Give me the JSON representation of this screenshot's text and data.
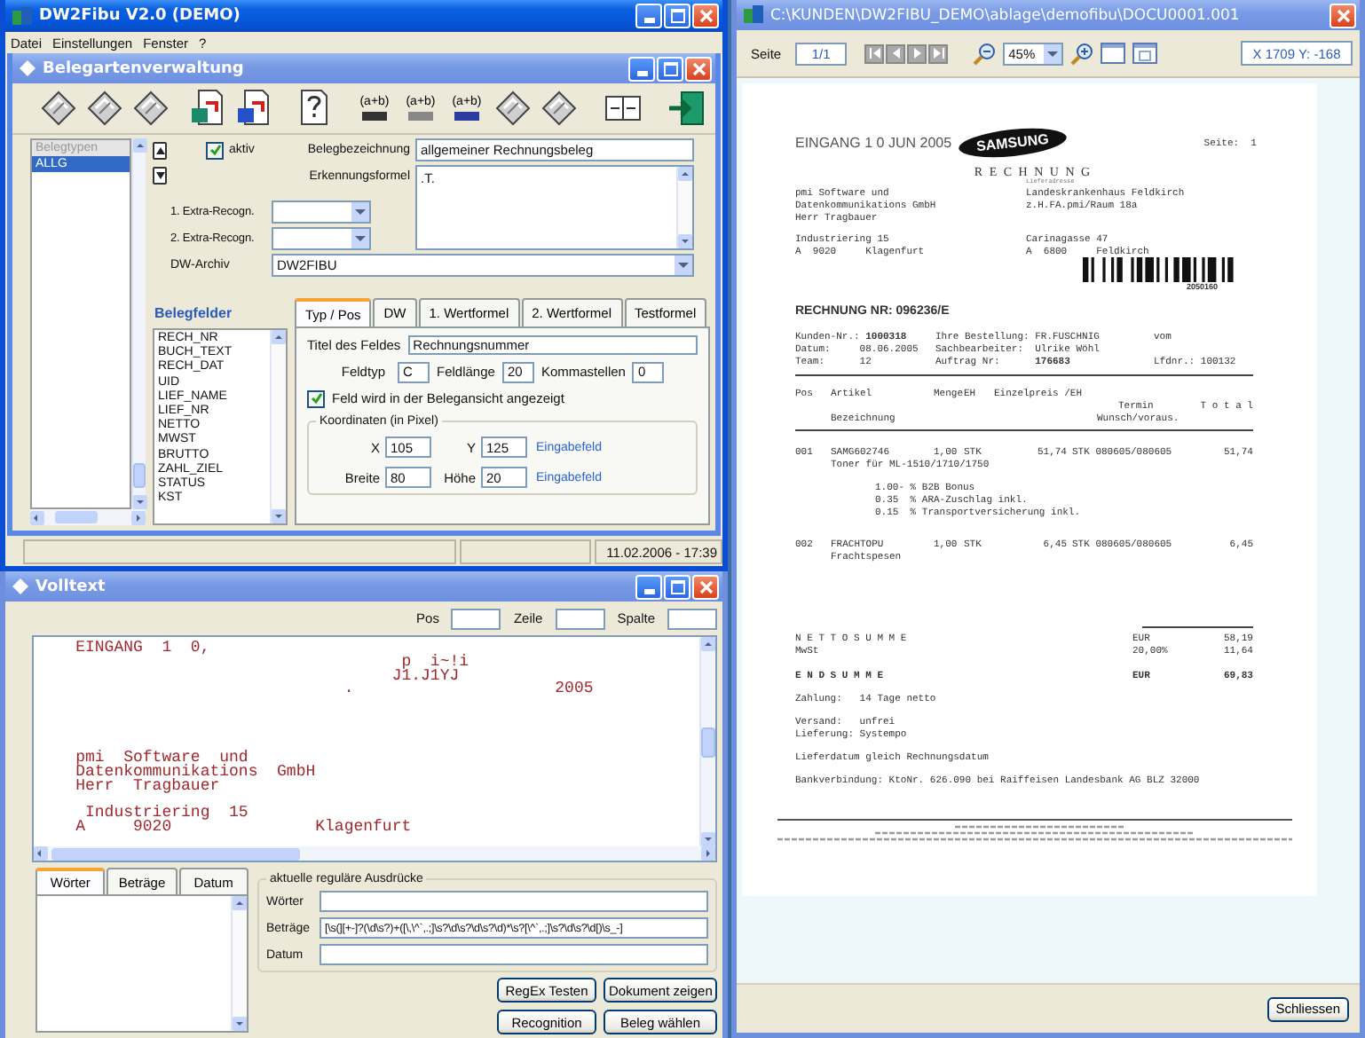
{
  "main_window": {
    "title": "DW2Fibu V2.0 (DEMO)",
    "menu": [
      "Datei",
      "Einstellungen",
      "Fenster",
      "?"
    ]
  },
  "belegarten": {
    "title": "Belegartenverwaltung",
    "toolbar": [
      {
        "kind": "tool"
      },
      {
        "kind": "tool"
      },
      {
        "kind": "tool"
      },
      {
        "kind": "page"
      },
      {
        "kind": "page"
      },
      {
        "kind": "help"
      },
      {
        "kind": "formula",
        "label": "(a+b)"
      },
      {
        "kind": "formula",
        "label": "(a+b)"
      },
      {
        "kind": "formula",
        "label": "(a+b)"
      },
      {
        "kind": "tool"
      },
      {
        "kind": "tool"
      },
      {
        "kind": "split"
      },
      {
        "kind": "exit"
      }
    ],
    "belegtypen": {
      "header": "Belegtypen",
      "items": [
        {
          "label": "ALLG",
          "selected": true
        }
      ]
    },
    "aktiv": {
      "label": "aktiv",
      "checked": true
    },
    "bezeichnung": {
      "label": "Belegbezeichnung",
      "value": "allgemeiner Rechnungsbeleg"
    },
    "formel": {
      "label": "Erkennungsformel",
      "value": ".T."
    },
    "extra_recogn": [
      {
        "label": "1. Extra-Recogn."
      },
      {
        "label": "2. Extra-Recogn."
      }
    ],
    "archiv": {
      "label": "DW-Archiv",
      "value": "DW2FIBU"
    },
    "belegfelder": {
      "title": "Belegfelder",
      "items": [
        {
          "label": "RECH_NR",
          "selected": false
        },
        {
          "label": "BUCH_TEXT",
          "selected": false
        },
        {
          "label": "RECH_DAT",
          "selected": false
        },
        {
          "label": "UID",
          "selected": false
        },
        {
          "label": "LIEF_NAME",
          "selected": false
        },
        {
          "label": "LIEF_NR",
          "selected": false
        },
        {
          "label": "NETTO",
          "selected": false
        },
        {
          "label": "MWST",
          "selected": false
        },
        {
          "label": "BRUTTO",
          "selected": false
        },
        {
          "label": "ZAHL_ZIEL",
          "selected": false
        },
        {
          "label": "STATUS",
          "selected": false
        },
        {
          "label": "KST",
          "selected": false
        }
      ]
    },
    "tabs": [
      {
        "label": "Typ / Pos",
        "selected": true
      },
      {
        "label": "DW",
        "selected": false
      },
      {
        "label": "1. Wertformel",
        "selected": false
      },
      {
        "label": "2. Wertformel",
        "selected": false
      },
      {
        "label": "Testformel",
        "selected": false
      }
    ],
    "panel": {
      "titel": {
        "label": "Titel des Feldes",
        "value": "Rechnungsnummer"
      },
      "feldtyp": {
        "label": "Feldtyp",
        "value": "C"
      },
      "feldlaenge": {
        "label": "Feldlänge",
        "value": "20"
      },
      "komma": {
        "label": "Kommastellen",
        "value": "0"
      },
      "anzeigen": {
        "label": "Feld wird in der Belegansicht angezeigt",
        "checked": true
      },
      "koordinaten": {
        "title": "Koordinaten (in Pixel)",
        "rows": [
          {
            "label_a": "X",
            "value_a": "105",
            "label_b": "Y",
            "value_b": "125",
            "link": "Eingabefeld"
          },
          {
            "label_a": "Breite",
            "value_a": "80",
            "label_b": "Höhe",
            "value_b": "20",
            "link": "Eingabefeld"
          }
        ]
      }
    }
  },
  "status_bar": {
    "datetime": "11.02.2006 - 17:39"
  },
  "volltext": {
    "title": "Volltext",
    "pos_label": "Pos",
    "zeile_label": "Zeile",
    "spalte_label": "Spalte",
    "ocr_text": "    EINGANG  1  0,\n                                      p  i~!i\n                                     J1.J1YJ\n                                .                     2005\n\n\n\n\n    pmi  Software  und\n    Datenkommunikations  GmbH\n    Herr  Tragbauer\n\n     Industriering  15\n    A     9020               Klagenfurt",
    "tabs": [
      {
        "label": "Wörter",
        "selected": true
      },
      {
        "label": "Beträge",
        "selected": false
      },
      {
        "label": "Datum",
        "selected": false
      }
    ],
    "regex_title": "aktuelle reguläre Ausdrücke",
    "regex_rows": [
      {
        "label": "Wörter"
      },
      {
        "label": "Beträge",
        "value": "[\\s(][+-]?(\\d\\s?)+([\\,\\^`,.;]\\s?\\d\\s?\\d\\s?\\d)*\\s?[\\^`,.;]\\s?\\d\\s?\\d[)\\s_-]"
      },
      {
        "label": "Datum"
      }
    ],
    "buttons": [
      "RegEx Testen",
      "Dokument zeigen",
      "Recognition",
      "Beleg wählen"
    ]
  },
  "viewer": {
    "title": "C:\\KUNDEN\\DW2FIBU_DEMO\\ablage\\demofibu\\DOCU0001.001",
    "page_label": "Seite",
    "page": "1/1",
    "zoom": "45%",
    "coords": "X 1709 Y: -168",
    "close_button": "Schliessen",
    "document": {
      "stamp": "EINGANG 1 0 JUN 2005",
      "logo": "SAMSUNG",
      "page_no": "Seite:  1",
      "heading": "R E C H N U N G",
      "delivery_label": "Lieferadresse",
      "address": [
        [
          "pmi Software und",
          "Landeskrankenhaus Feldkirch"
        ],
        [
          "Datenkommunikations GmbH",
          "z.H.FA.pmi/Raum 18a"
        ],
        [
          "Herr Tragbauer"
        ]
      ],
      "address2": [
        [
          "Industriering 15",
          "Carinagasse 47"
        ],
        [
          "A  9020     Klagenfurt",
          "A  6800     Feldkirch"
        ]
      ],
      "barcode_number": "2050160",
      "invoice_no": "RECHNUNG NR: 096236/E",
      "info": [
        [
          "Kunden-Nr.: **1000318**",
          "Ihre Bestellung: FR.FUSCHNIG",
          "vom"
        ],
        [
          "Datum:     08.06.2005",
          "Sachbearbeiter:  Ulrike Wöhl"
        ],
        [
          "Team:      12",
          "Auftrag Nr:      **176683**",
          "Lfdnr.: 100132"
        ]
      ],
      "table_head": [
        "Pos",
        "Artikel",
        "Menge",
        "EH",
        "Einzelpreis /EH",
        "Termin",
        "T o t a l"
      ],
      "table_head2": [
        "Bezeichnung",
        "Wunsch/voraus."
      ],
      "items": [
        {
          "kind": "line",
          "cells": [
            "001",
            "SAMG602746",
            "1,00",
            "STK",
            "51,74",
            "STK 080605/080605",
            "51,74"
          ]
        },
        {
          "kind": "sub",
          "cells": [
            "Toner für ML-1510/1710/1750"
          ]
        },
        {
          "kind": "note",
          "cells": [
            "1.00- % B2B Bonus"
          ]
        },
        {
          "kind": "note",
          "cells": [
            "0.35  % ARA-Zuschlag inkl."
          ]
        },
        {
          "kind": "note",
          "cells": [
            "0.15  % Transportversicherung inkl."
          ]
        },
        {
          "kind": "line",
          "cells": [
            "002",
            "FRACHTOPU",
            "1,00",
            "STK",
            "6,45",
            "STK 080605/080605",
            "6,45"
          ]
        },
        {
          "kind": "sub",
          "cells": [
            "Frachtspesen"
          ]
        }
      ],
      "totals": [
        {
          "kind": "sum",
          "cells": [
            "N E T T O S U M M E",
            "EUR",
            "58,19"
          ]
        },
        {
          "kind": "sum",
          "cells": [
            "MwSt",
            "20,00%",
            "11,64"
          ]
        },
        {
          "kind": "grand",
          "cells": [
            "E N D S U M M E",
            "EUR",
            "69,83"
          ]
        }
      ],
      "closing": [
        [
          "Zahlung:   14 Tage netto"
        ],
        [
          "Versand:   unfrei",
          "Lieferung: Systempo"
        ],
        [
          "Lieferdatum gleich Rechnungsdatum"
        ],
        [
          "Bankverbindung: KtoNr. 626.090 bei Raiffeisen Landesbank AG BLZ 32000"
        ]
      ]
    }
  }
}
